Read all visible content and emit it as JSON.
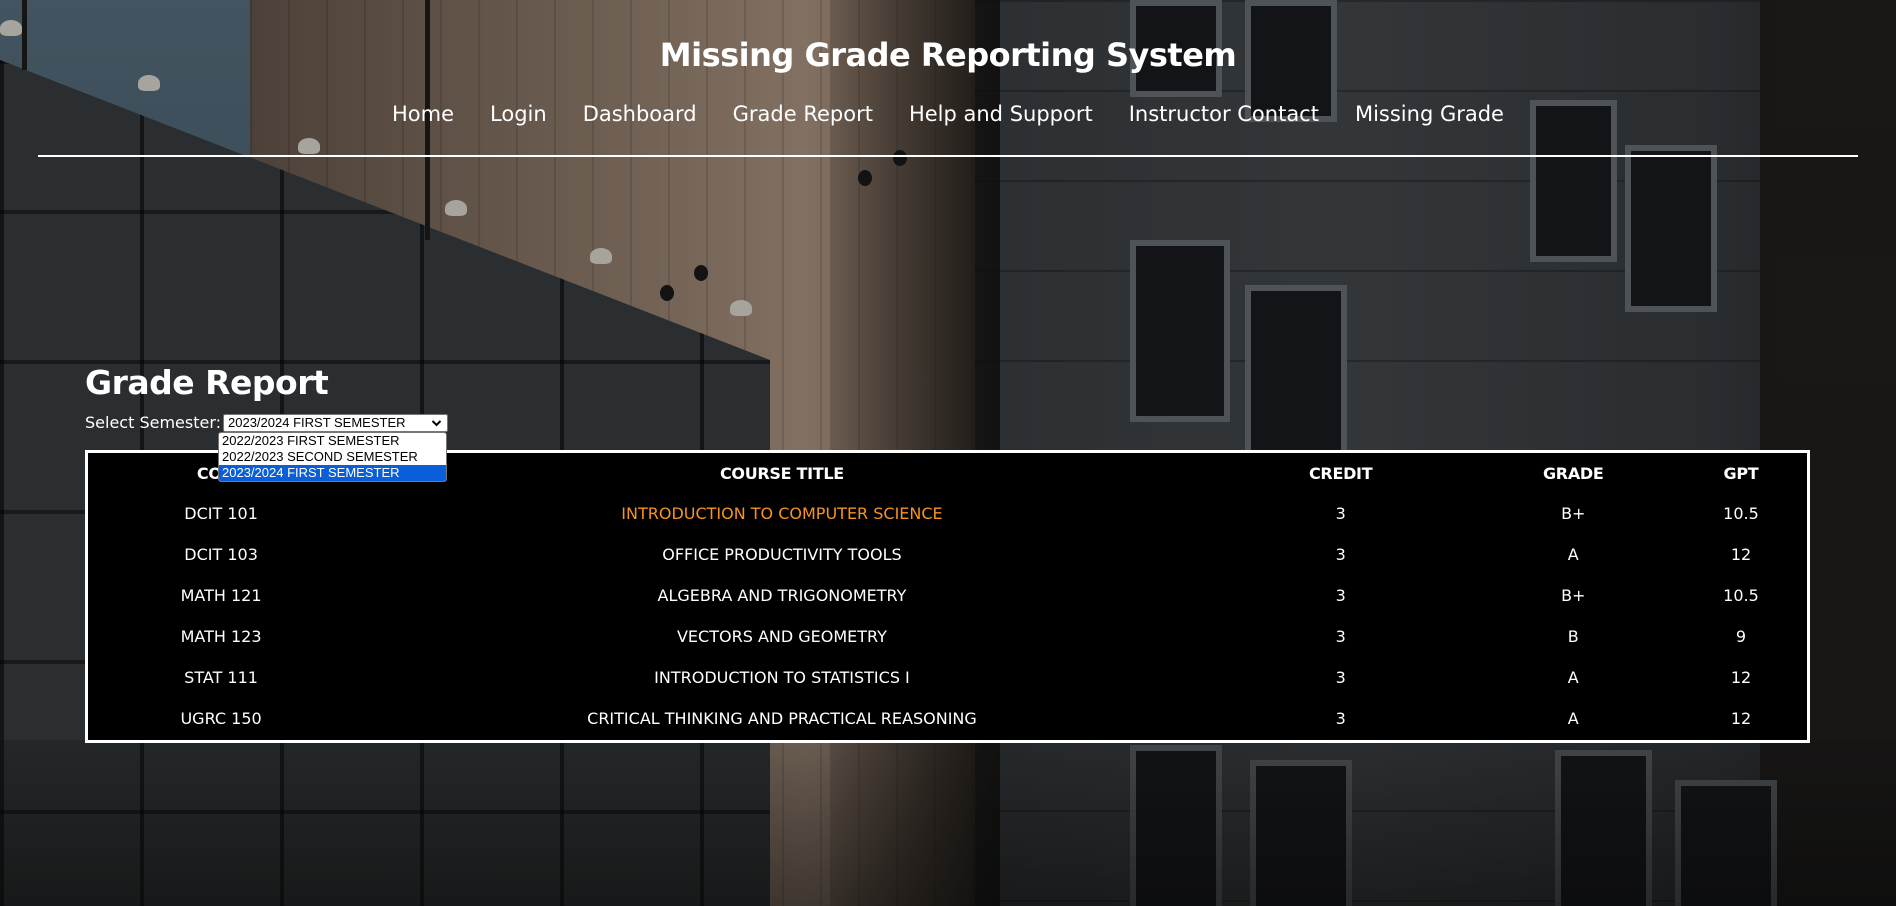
{
  "header": {
    "title": "Missing Grade Reporting System",
    "nav": [
      "Home",
      "Login",
      "Dashboard",
      "Grade Report",
      "Help and Support",
      "Instructor Contact",
      "Missing Grade"
    ]
  },
  "main": {
    "title": "Grade Report",
    "semester_label": "Select Semester:",
    "selected_semester": "2023/2024 FIRST SEMESTER",
    "semester_options": [
      "2022/2023 FIRST SEMESTER",
      "2022/2023 SECOND SEMESTER",
      "2023/2024 FIRST SEMESTER"
    ],
    "table": {
      "headers": [
        "CODE",
        "COURSE TITLE",
        "CREDIT",
        "GRADE",
        "GPT"
      ],
      "rows": [
        [
          "DCIT 101",
          "INTRODUCTION TO COMPUTER SCIENCE",
          "3",
          "B+",
          "10.5"
        ],
        [
          "DCIT 103",
          "OFFICE PRODUCTIVITY TOOLS",
          "3",
          "A",
          "12"
        ],
        [
          "MATH 121",
          "ALGEBRA AND TRIGONOMETRY",
          "3",
          "B+",
          "10.5"
        ],
        [
          "MATH 123",
          "VECTORS AND GEOMETRY",
          "3",
          "B",
          "9"
        ],
        [
          "STAT 111",
          "INTRODUCTION TO STATISTICS I",
          "3",
          "A",
          "12"
        ],
        [
          "UGRC 150",
          "CRITICAL THINKING AND PRACTICAL REASONING",
          "3",
          "A",
          "12"
        ]
      ]
    }
  },
  "colors": {
    "highlight_text": "#f7931e",
    "dropdown_selected": "#0a5fd8"
  },
  "icons": {
    "select_arrow": "chevron-down-icon"
  }
}
